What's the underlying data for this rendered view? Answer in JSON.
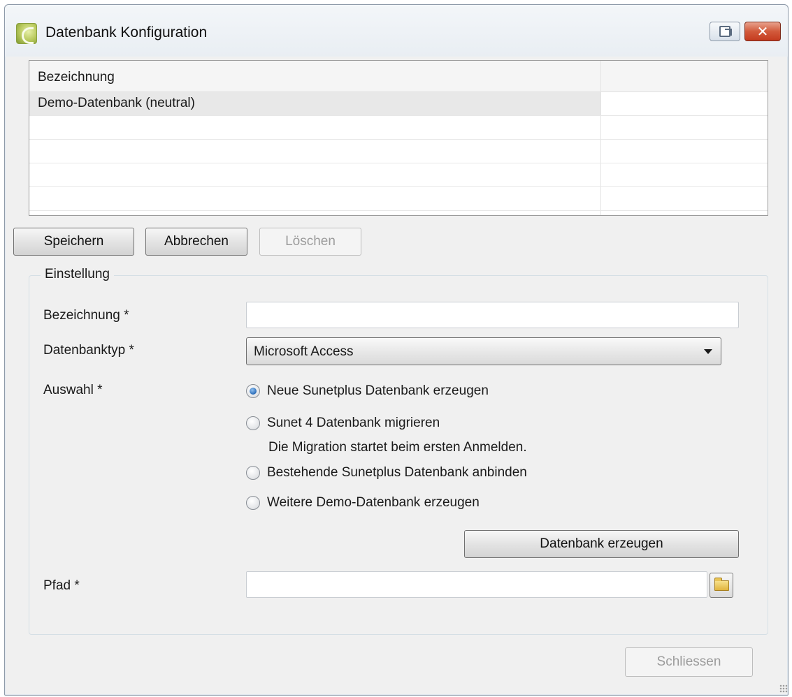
{
  "window": {
    "title": "Datenbank Konfiguration",
    "close_glyph": "✕"
  },
  "grid": {
    "columns": [
      "Bezeichnung",
      ""
    ],
    "rows": [
      {
        "name": "Demo-Datenbank (neutral)",
        "selected": true
      },
      {
        "name": ""
      },
      {
        "name": ""
      },
      {
        "name": ""
      },
      {
        "name": ""
      }
    ]
  },
  "toolbar": {
    "save_label": "Speichern",
    "cancel_label": "Abbrechen",
    "delete_label": "Löschen"
  },
  "settings": {
    "group_title": "Einstellung",
    "name_label": "Bezeichnung *",
    "name_value": "",
    "dbtype_label": "Datenbanktyp *",
    "dbtype_value": "Microsoft Access",
    "choice_label": "Auswahl *",
    "options": [
      {
        "label": "Neue Sunetplus Datenbank erzeugen",
        "checked": true
      },
      {
        "label": "Sunet 4 Datenbank migrieren",
        "checked": false
      },
      {
        "label": "Bestehende Sunetplus Datenbank anbinden",
        "checked": false
      },
      {
        "label": "Weitere Demo-Datenbank erzeugen",
        "checked": false
      }
    ],
    "migration_note": "Die Migration startet beim ersten Anmelden.",
    "create_db_label": "Datenbank erzeugen",
    "path_label": "Pfad *",
    "path_value": ""
  },
  "footer": {
    "close_label": "Schliessen"
  },
  "icons": {
    "app": "app-logo-icon",
    "help": "help-icon",
    "close": "close-icon",
    "folder": "folder-icon"
  }
}
